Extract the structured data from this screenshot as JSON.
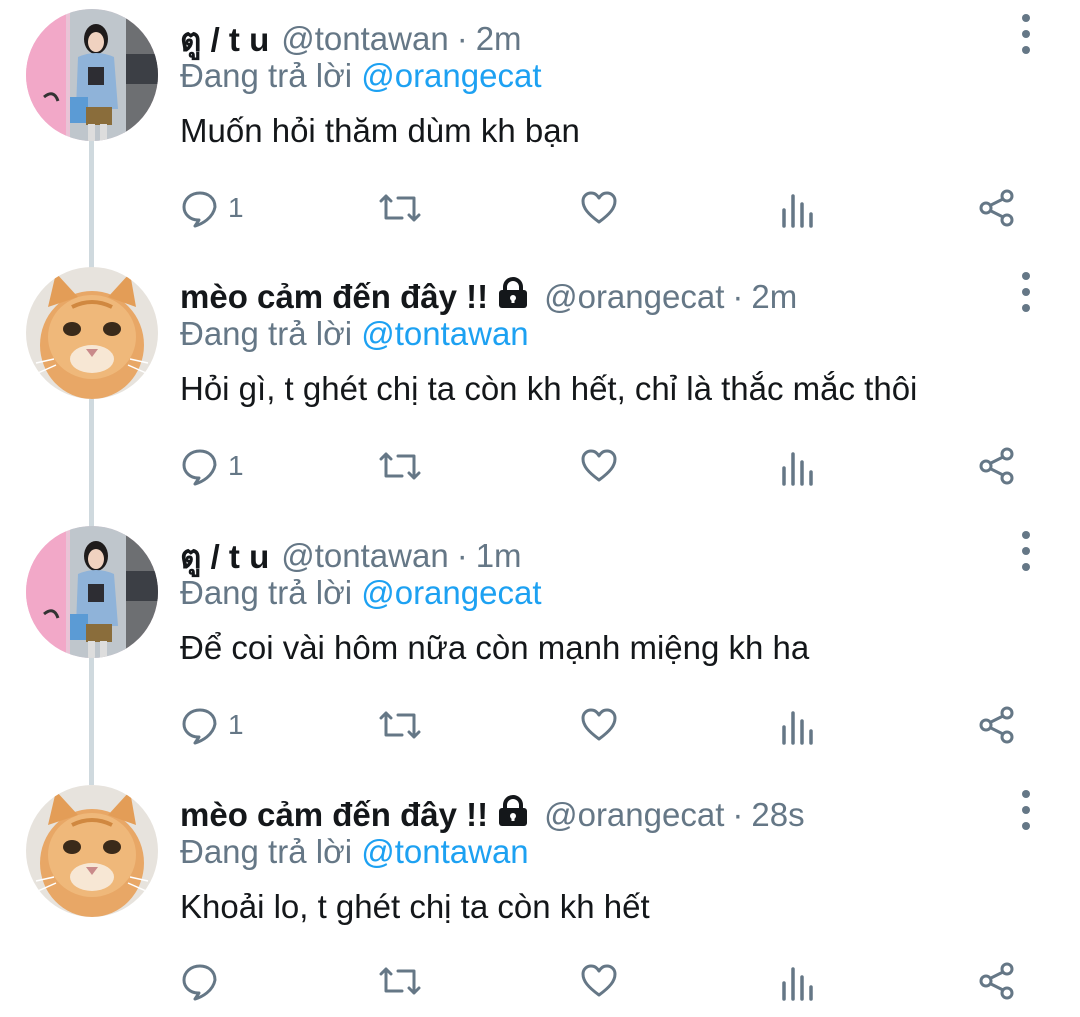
{
  "thread": {
    "replying_prefix": "Đang trả lời",
    "tweets": [
      {
        "name": "ตู / t u",
        "handle": "@tontawan",
        "separator": "·",
        "time": "2m",
        "reply_to": "@orangecat",
        "text": "Muốn hỏi thăm dùm kh bạn",
        "reply_count": "1",
        "avatar": "avatar-girl",
        "locked": false
      },
      {
        "name": "mèo cảm đến đây !!",
        "handle": "@orangecat",
        "separator": "·",
        "time": "2m",
        "reply_to": "@tontawan",
        "text": "Hỏi gì, t ghét chị ta còn kh hết, chỉ là thắc mắc thôi",
        "reply_count": "1",
        "avatar": "avatar-cat",
        "locked": true
      },
      {
        "name": "ตู / t u",
        "handle": "@tontawan",
        "separator": "·",
        "time": "1m",
        "reply_to": "@orangecat",
        "text": "Để coi vài hôm nữa còn mạnh miệng kh ha",
        "reply_count": "1",
        "avatar": "avatar-girl",
        "locked": false
      },
      {
        "name": "mèo cảm đến đây !!",
        "handle": "@orangecat",
        "separator": "·",
        "time": "28s",
        "reply_to": "@tontawan",
        "text": "Khoải lo, t ghét chị ta còn kh hết",
        "reply_count": "",
        "avatar": "avatar-cat",
        "locked": true
      }
    ]
  },
  "icons": {
    "reply": "reply-icon",
    "retweet": "retweet-icon",
    "like": "heart-icon",
    "analytics": "analytics-icon",
    "share": "share-icon",
    "more": "more-vertical-icon",
    "lock": "lock-icon"
  },
  "colors": {
    "mention": "#1da1f2",
    "secondary_text": "#657786",
    "thread_line": "#cfd9de"
  }
}
